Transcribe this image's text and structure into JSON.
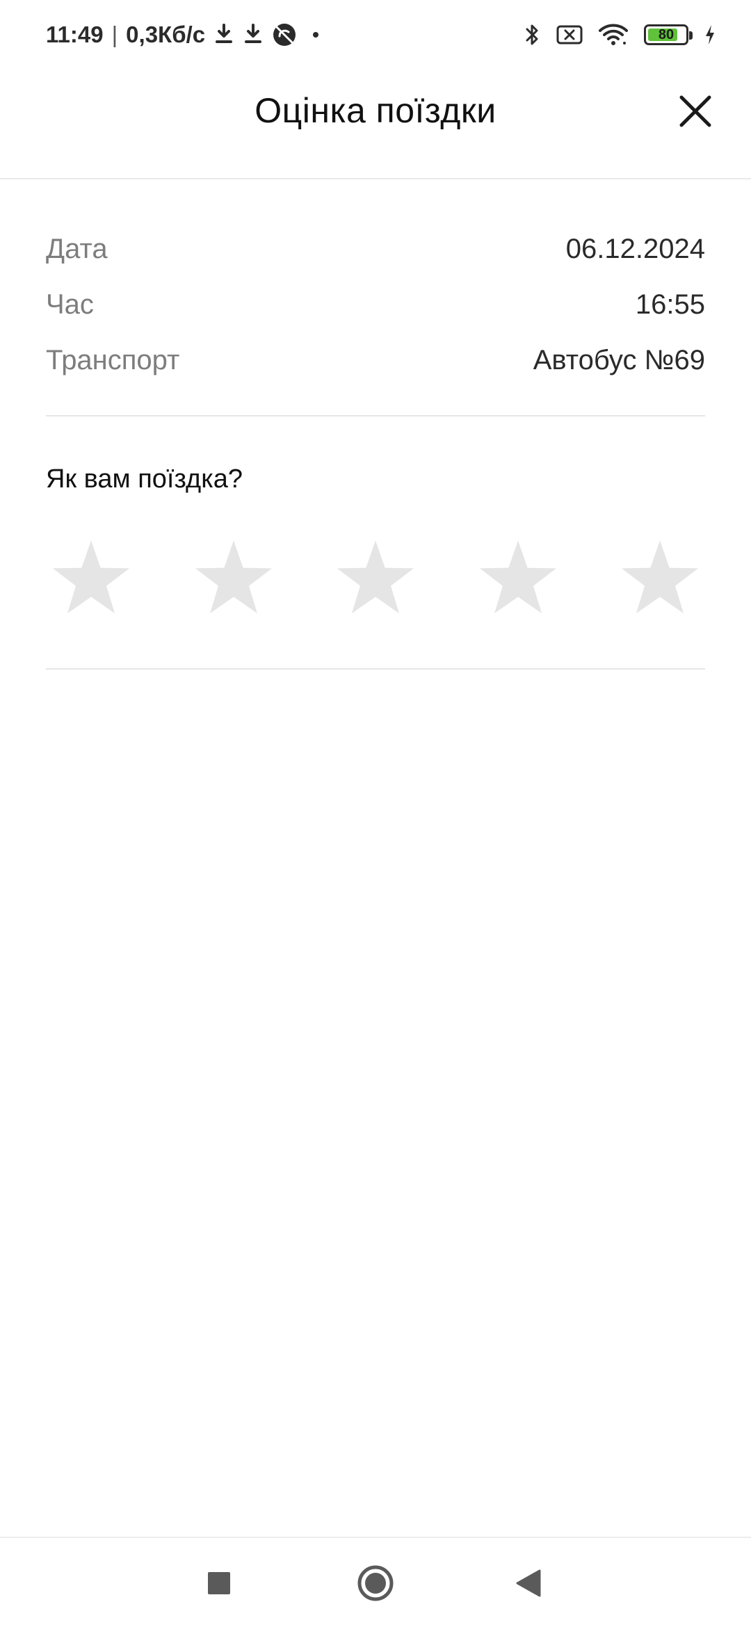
{
  "status_bar": {
    "time": "11:49",
    "separator": "|",
    "network_speed": "0,3Кб/с",
    "battery_percent": "80",
    "battery_level": 0.8,
    "icons": [
      "download-icon",
      "download-icon",
      "data-saver-off-icon",
      "notification-dot-icon",
      "bluetooth-icon",
      "no-sim-icon",
      "wifi-icon",
      "battery-icon",
      "charging-icon"
    ]
  },
  "header": {
    "title": "Оцінка поїздки",
    "close_icon": "close-icon"
  },
  "trip": {
    "rows": [
      {
        "label": "Дата",
        "value": "06.12.2024"
      },
      {
        "label": "Час",
        "value": "16:55"
      },
      {
        "label": "Транспорт",
        "value": "Автобус №69"
      }
    ]
  },
  "rating": {
    "question": "Як вам поїздка?",
    "max_stars": 5,
    "selected": 0,
    "star_color_empty": "#e5e5e5"
  },
  "nav_bar": {
    "buttons": [
      "recents-icon",
      "home-icon",
      "back-icon"
    ]
  }
}
